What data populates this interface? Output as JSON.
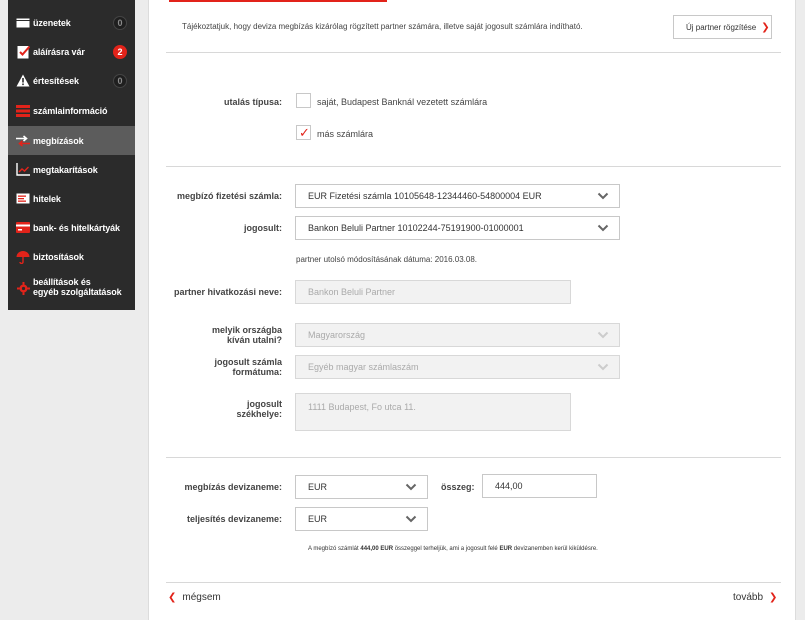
{
  "sidebar": {
    "items": [
      {
        "label": "üzenetek",
        "badge": "0",
        "icon": "mail-icon"
      },
      {
        "label": "aláírásra vár",
        "badge": "2",
        "icon": "signature-icon"
      },
      {
        "label": "értesítések",
        "badge": "0",
        "icon": "warning-icon"
      },
      {
        "label": "számlainformáció",
        "icon": "account-info-icon"
      },
      {
        "label": "megbízások",
        "icon": "transfer-icon"
      },
      {
        "label": "megtakarítások",
        "icon": "savings-chart-icon"
      },
      {
        "label": "hitelek",
        "icon": "loan-icon"
      },
      {
        "label": "bank- és hitelkártyák",
        "icon": "card-icon"
      },
      {
        "label": "biztosítások",
        "icon": "umbrella-icon"
      },
      {
        "label_line1": "beállítások és",
        "label_line2": "egyéb szolgáltatások",
        "icon": "gear-icon"
      }
    ]
  },
  "header": {
    "info_text": "Tájékoztatjuk, hogy deviza megbízás kizárólag rögzített partner számára, illetve saját jogosult számlára indítható.",
    "new_partner_button": "Új partner rögzítése",
    "chevron": "❯"
  },
  "transfer_type": {
    "label": "utalás típusa:",
    "option1": "saját, Budapest Banknál vezetett számlára",
    "option2": "más számlára",
    "checkmark": "✓"
  },
  "form": {
    "payer_account_label": "megbízó fizetési számla:",
    "payer_account_value": "EUR Fizetési számla 10105648-12344460-54800004 EUR",
    "beneficiary_label": "jogosult:",
    "beneficiary_value": "Bankon Beluli Partner 10102244-75191900-01000001",
    "partner_modified_text": "partner utolsó módosításának dátuma: 2016.03.08.",
    "partner_name_label": "partner hivatkozási neve:",
    "partner_name_value": "Bankon Beluli Partner",
    "country_label_line1": "melyik országba",
    "country_label_line2": "kíván utalni?",
    "country_value": "Magyarország",
    "account_format_label_line1": "jogosult számla",
    "account_format_label_line2": "formátuma:",
    "account_format_value": "Egyéb magyar számlaszám",
    "address_label_line1": "jogosult",
    "address_label_line2": "székhelye:",
    "address_value": "1111 Budapest, Fo utca 11."
  },
  "currency": {
    "order_currency_label": "megbízás devizaneme:",
    "order_currency_value": "EUR",
    "amount_label": "összeg:",
    "amount_value": "444,00",
    "settlement_currency_label": "teljesítés devizaneme:",
    "settlement_currency_value": "EUR",
    "note_prefix": "A megbízó számlát ",
    "note_amount": "444,00 EUR",
    "note_middle": " összeggel terheljük, ami a jogosult felé ",
    "note_currency": "EUR",
    "note_suffix": " devizanemben kerül kiküldésre."
  },
  "footer": {
    "cancel": "mégsem",
    "next": "tovább",
    "prev_chevron": "❮",
    "next_chevron": "❯"
  },
  "colors": {
    "accent": "#e2231a",
    "sidebar_bg": "#2b2b2b",
    "active_item": "#5c5c5c"
  }
}
